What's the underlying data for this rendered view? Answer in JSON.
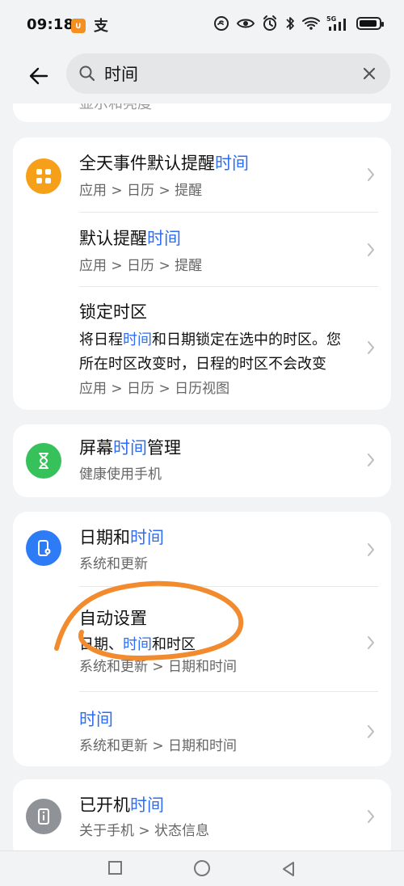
{
  "status_bar": {
    "time": "09:18",
    "mini_app_label": "∪",
    "payment_char": "支",
    "network": "5G"
  },
  "search": {
    "value": "时间"
  },
  "partial": {
    "label": "显示和亮度"
  },
  "cards": [
    {
      "icon": "apps-grid-icon",
      "color": "#f6a01a",
      "rows": [
        {
          "title_before": "全天事件默认提醒",
          "title_highlight": "时间",
          "title_after": "",
          "path": "应用 > 日历 > 提醒"
        },
        {
          "title_before": "默认提醒",
          "title_highlight": "时间",
          "title_after": "",
          "path": "应用 > 日历 > 提醒"
        },
        {
          "title_before": "锁定时区",
          "title_highlight": "",
          "title_after": "",
          "desc_line1_before": "将日程",
          "desc_line1_highlight": "时间",
          "desc_line1_after": "和日期锁定在选中的时区。您",
          "desc_line2": "所在时区改变时，日程的时区不会改变",
          "path": "应用 > 日历 > 日历视图"
        }
      ]
    },
    {
      "icon": "hourglass-icon",
      "color": "#37c15a",
      "rows": [
        {
          "title_before": "屏幕",
          "title_highlight": "时间",
          "title_after": "管理",
          "path": "健康使用手机"
        }
      ]
    },
    {
      "icon": "phone-settings-icon",
      "color": "#2d7cf6",
      "rows": [
        {
          "title_before": "日期和",
          "title_highlight": "时间",
          "title_after": "",
          "path": "系统和更新"
        },
        {
          "title_before": "自动设置",
          "title_highlight": "",
          "title_after": "",
          "desc_before": "日期、",
          "desc_highlight": "时间",
          "desc_after": "和时区",
          "path": "系统和更新 > 日期和时间"
        },
        {
          "title_before": "",
          "title_highlight": "时间",
          "title_after": "",
          "path": "系统和更新 > 日期和时间"
        }
      ]
    },
    {
      "icon": "info-phone-icon",
      "color": "#8f9398",
      "rows": [
        {
          "title_before": "已开机",
          "title_highlight": "时间",
          "title_after": "",
          "path": "关于手机 > 状态信息"
        }
      ]
    }
  ],
  "colors": {
    "accent": "#2f6df4",
    "annotation": "#f28a2e"
  }
}
